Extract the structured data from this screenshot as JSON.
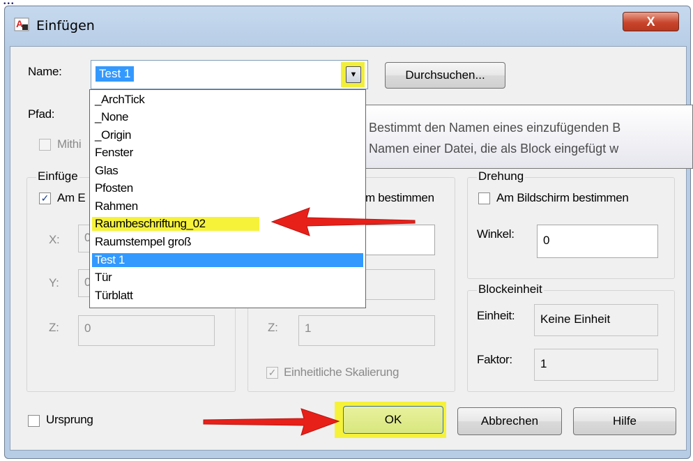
{
  "window": {
    "title": "Einfügen",
    "close_glyph": "X"
  },
  "name_field": {
    "label": "Name:",
    "value": "Test 1",
    "browse_label": "Durchsuchen..."
  },
  "path": {
    "label": "Pfad:",
    "georef_label": "Mithi"
  },
  "insertion_point": {
    "title": "Einfüge",
    "onscreen_label": "Am E",
    "x_label": "X:",
    "x_value": "0",
    "y_label": "Y:",
    "y_value": "0",
    "z_label": "Z:",
    "z_value": "0"
  },
  "scale": {
    "onscreen_label": "m bestimmen",
    "z_label": "Z:",
    "z_value": "1",
    "uniform_label": "Einheitliche Skalierung"
  },
  "rotation": {
    "title": "Drehung",
    "onscreen_label": "Am Bildschirm bestimmen",
    "angle_label": "Winkel:",
    "angle_value": "0"
  },
  "block_unit": {
    "title": "Blockeinheit",
    "unit_label": "Einheit:",
    "unit_value": "Keine Einheit",
    "factor_label": "Faktor:",
    "factor_value": "1"
  },
  "dropdown": {
    "items": [
      "_ArchTick",
      "_None",
      "_Origin",
      "Fenster",
      "Glas",
      "Pfosten",
      "Rahmen",
      "Raumbeschriftung_02",
      "Raumstempel groß",
      "Test 1",
      "Tür",
      "Türblatt"
    ],
    "highlighted": "Raumbeschriftung_02",
    "selected": "Test 1"
  },
  "tooltip": {
    "line1": "Bestimmt den Namen eines einzufügenden B",
    "line2": "Namen einer Datei, die als Block eingefügt w"
  },
  "footer": {
    "explode_label": "Ursprung",
    "ok_label": "OK",
    "cancel_label": "Abbrechen",
    "help_label": "Hilfe"
  },
  "colors": {
    "highlight": "#f6f23a",
    "selection": "#3399ff",
    "arrow": "#e8201a"
  },
  "top_strip": {
    "text": "...",
    "link": "..."
  }
}
